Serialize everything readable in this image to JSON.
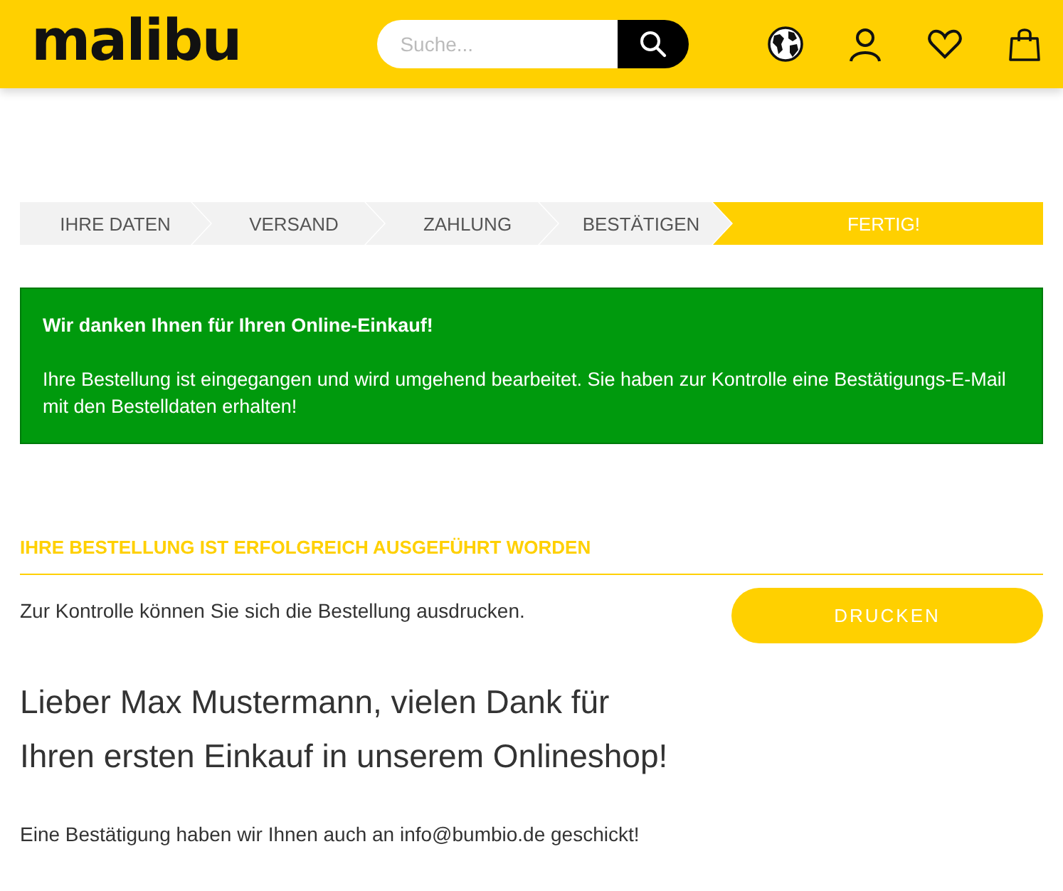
{
  "header": {
    "logo": "malibu",
    "search": {
      "placeholder": "Suche..."
    }
  },
  "steps": [
    {
      "label": "IHRE DATEN",
      "selected": false
    },
    {
      "label": "VERSAND",
      "selected": false
    },
    {
      "label": "ZAHLUNG",
      "selected": false
    },
    {
      "label": "BESTÄTIGEN",
      "selected": false
    },
    {
      "label": "FERTIG!",
      "selected": true
    }
  ],
  "alert": {
    "title": "Wir danken Ihnen für Ihren Online-Einkauf!",
    "text": "Ihre Bestellung ist eingegangen und wird umgehend bearbeitet. Sie haben zur Kontrolle eine Bestätigungs-E-Mail mit den Bestelldaten erhalten!"
  },
  "section_title": "IHRE BESTELLUNG IST ERFOLGREICH AUSGEFÜHRT WORDEN",
  "print_hint": "Zur Kontrolle können Sie sich die Bestellung ausdrucken.",
  "print_button": "DRUCKEN",
  "greeting": "Lieber Max Mustermann, vielen Dank für Ihren ersten Einkauf in unserem Onlineshop!",
  "confirmation": "Eine Bestätigung haben wir Ihnen auch an info@bumbio.de geschickt!"
}
